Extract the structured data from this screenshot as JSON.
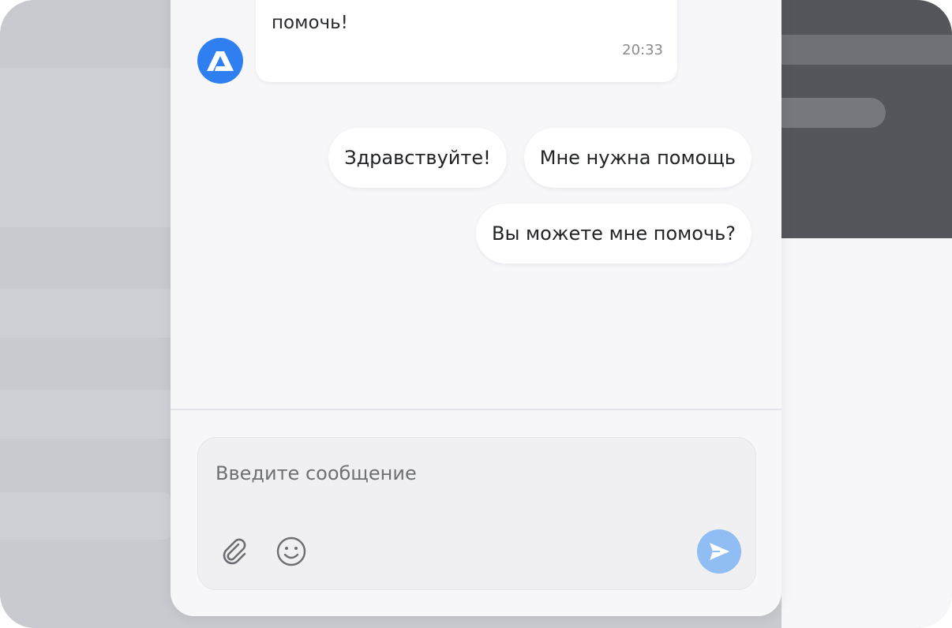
{
  "chat": {
    "bot_message": {
      "text": "помочь!",
      "time": "20:33"
    },
    "quick_replies": [
      {
        "label": "Здравствуйте!"
      },
      {
        "label": "Мне нужна помощь"
      },
      {
        "label": "Вы можете мне помочь?"
      }
    ],
    "composer": {
      "placeholder": "Введите сообщение"
    }
  },
  "icons": {
    "avatar": "brand-logo-icon",
    "attach": "paperclip-icon",
    "emoji": "smiley-icon",
    "send": "send-arrow-icon"
  },
  "colors": {
    "accent": "#2f7ff1",
    "send_button": "#8fbdf4",
    "panel_bg": "#f7f7fa",
    "bubble_bg": "#ffffff"
  }
}
